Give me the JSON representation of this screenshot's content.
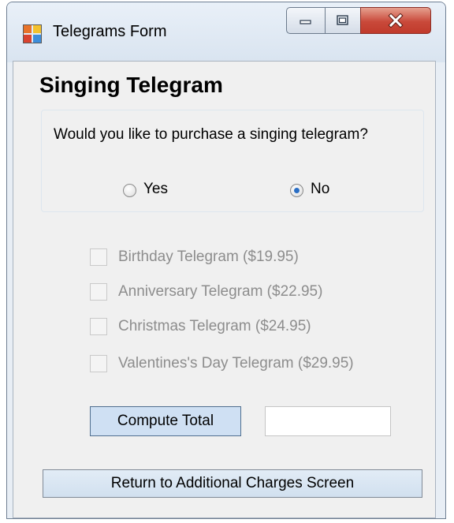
{
  "window": {
    "title": "Telegrams Form",
    "icon": "windows-forms-app-icon"
  },
  "title_buttons": {
    "minimize": "minimize-icon",
    "maximize": "maximize-icon",
    "close": "close-icon",
    "close_color": "#c9493a"
  },
  "form": {
    "heading": "Singing Telegram",
    "question": "Would you like to purchase a singing telegram?",
    "radio_yes": {
      "label": "Yes",
      "checked": false
    },
    "radio_no": {
      "label": "No",
      "checked": true
    },
    "options": [
      {
        "label": "Birthday Telegram ($19.95)",
        "checked": false,
        "enabled": false
      },
      {
        "label": "Anniversary Telegram ($22.95)",
        "checked": false,
        "enabled": false
      },
      {
        "label": "Christmas Telegram ($24.95)",
        "checked": false,
        "enabled": false
      },
      {
        "label": "Valentines's Day Telegram ($29.95)",
        "checked": false,
        "enabled": false
      }
    ],
    "compute_label": "Compute Total",
    "total_value": "",
    "return_label": "Return to Additional Charges Screen"
  }
}
